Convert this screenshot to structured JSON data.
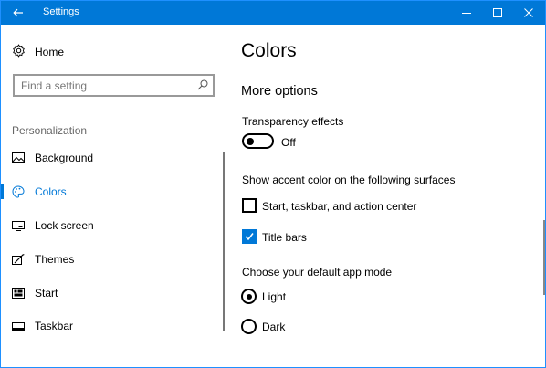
{
  "window": {
    "title": "Settings",
    "accent_color": "#0078d7"
  },
  "sidebar": {
    "home_label": "Home",
    "search_placeholder": "Find a setting",
    "section_label": "Personalization",
    "items": [
      {
        "label": "Background",
        "icon": "picture-icon",
        "active": false
      },
      {
        "label": "Colors",
        "icon": "palette-icon",
        "active": true
      },
      {
        "label": "Lock screen",
        "icon": "monitor-icon",
        "active": false
      },
      {
        "label": "Themes",
        "icon": "brush-icon",
        "active": false
      },
      {
        "label": "Start",
        "icon": "start-layout-icon",
        "active": false
      },
      {
        "label": "Taskbar",
        "icon": "taskbar-icon",
        "active": false
      }
    ]
  },
  "main": {
    "title": "Colors",
    "subheading": "More options",
    "transparency": {
      "label": "Transparency effects",
      "state": "Off",
      "on": false
    },
    "accent_surfaces": {
      "label": "Show accent color on the following surfaces",
      "options": [
        {
          "label": "Start, taskbar, and action center",
          "checked": false
        },
        {
          "label": "Title bars",
          "checked": true
        }
      ]
    },
    "app_mode": {
      "label": "Choose your default app mode",
      "options": [
        {
          "label": "Light",
          "selected": true
        },
        {
          "label": "Dark",
          "selected": false
        }
      ]
    }
  }
}
